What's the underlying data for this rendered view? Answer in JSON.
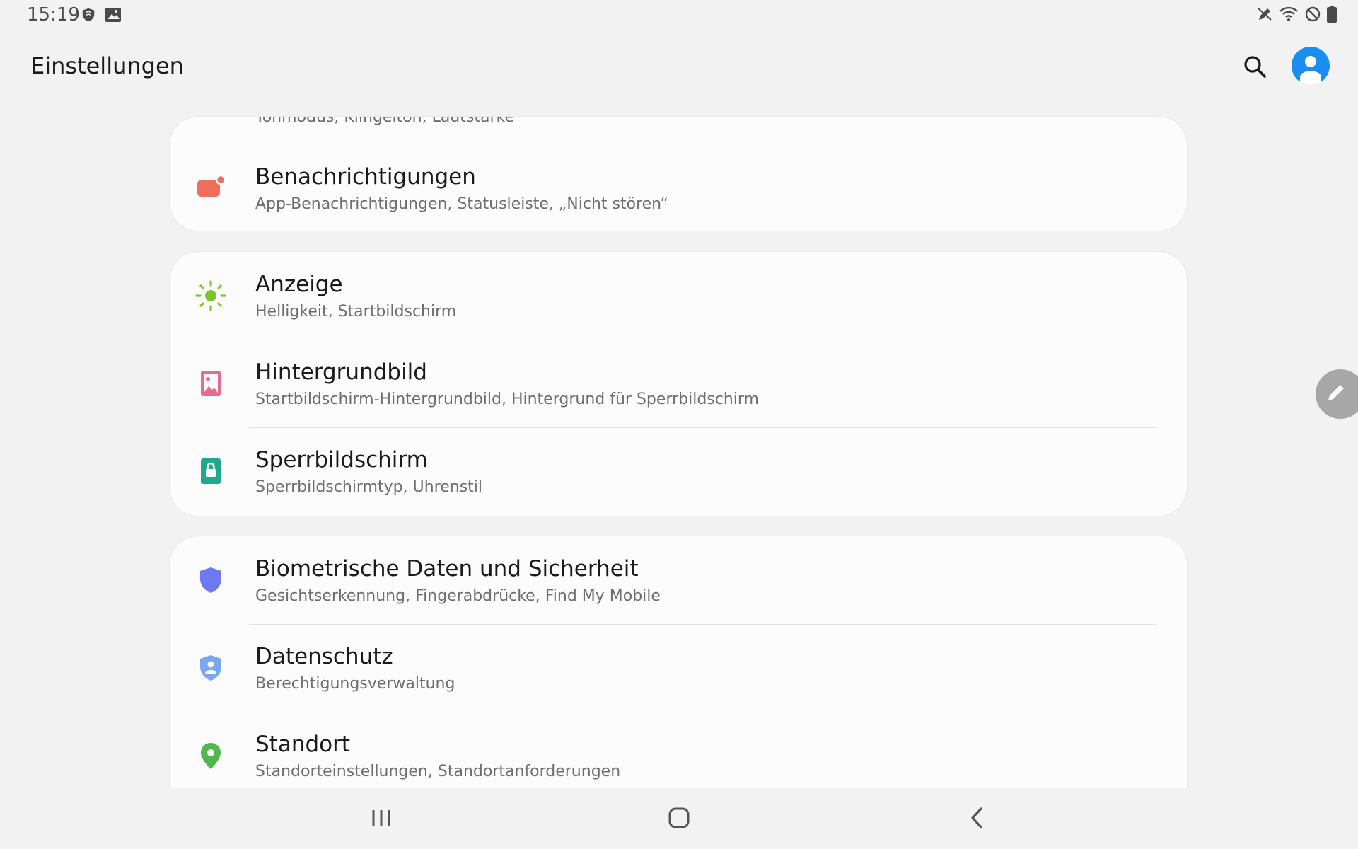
{
  "status_bar": {
    "time": "15:19",
    "left_icons": [
      "shield-notification-icon",
      "image-notification-icon"
    ],
    "right_icons": [
      "pen-off-icon",
      "wifi-icon",
      "do-not-disturb-icon",
      "battery-icon"
    ]
  },
  "header": {
    "title": "Einstellungen",
    "search_icon": "search-icon",
    "account_icon": "account-avatar-icon",
    "accent_color": "#1a8ef0"
  },
  "cards": {
    "card1": {
      "partial_subtitle": "Tonmodus, Klingelton, Lautstärke",
      "items": [
        {
          "title": "Benachrichtigungen",
          "subtitle": "App-Benachrichtigungen, Statusleiste, „Nicht stören“",
          "icon": "notifications-icon",
          "color": "#ee6f5c"
        }
      ]
    },
    "card2": {
      "items": [
        {
          "title": "Anzeige",
          "subtitle": "Helligkeit, Startbildschirm",
          "icon": "brightness-icon",
          "color": "#7bc72a"
        },
        {
          "title": "Hintergrundbild",
          "subtitle": "Startbildschirm-Hintergrundbild, Hintergrund für Sperrbildschirm",
          "icon": "wallpaper-icon",
          "color": "#e46c8c"
        },
        {
          "title": "Sperrbildschirm",
          "subtitle": "Sperrbildschirmtyp, Uhrenstil",
          "icon": "lock-screen-icon",
          "color": "#1fa88e"
        }
      ]
    },
    "card3": {
      "items": [
        {
          "title": "Biometrische Daten und Sicherheit",
          "subtitle": "Gesichtserkennung, Fingerabdrücke, Find My Mobile",
          "icon": "security-shield-icon",
          "color": "#6e78f0"
        },
        {
          "title": "Datenschutz",
          "subtitle": "Berechtigungsverwaltung",
          "icon": "privacy-icon",
          "color": "#7aa8ef"
        },
        {
          "title": "Standort",
          "subtitle": "Standorteinstellungen, Standortanforderungen",
          "icon": "location-icon",
          "color": "#4fb84c"
        }
      ]
    }
  },
  "edge_panel": {
    "icon": "pencil-icon"
  },
  "nav_bar": {
    "buttons": [
      "recents-icon",
      "home-icon",
      "back-icon"
    ]
  }
}
